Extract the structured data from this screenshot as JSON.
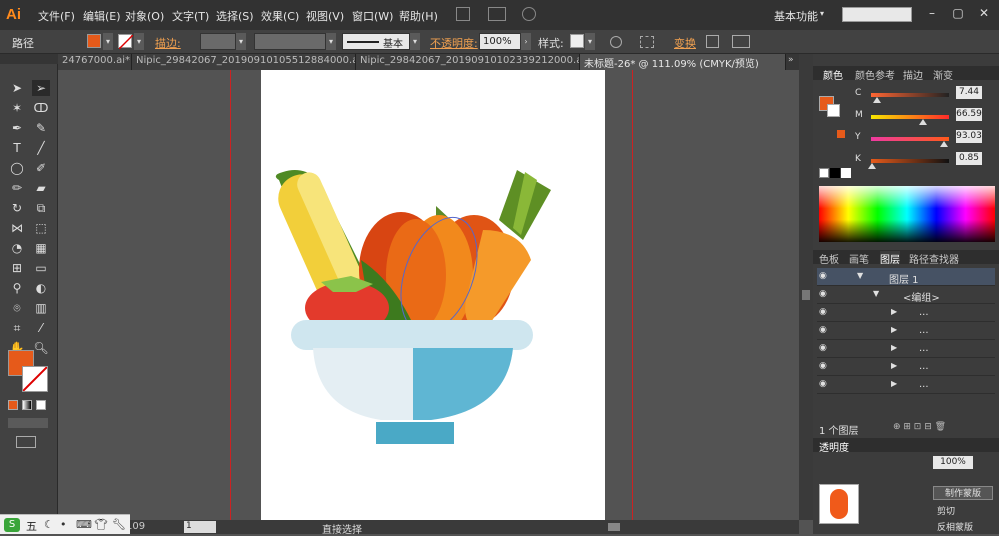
{
  "app": {
    "logo": "Ai"
  },
  "menu": [
    "文件(F)",
    "编辑(E)",
    "对象(O)",
    "文字(T)",
    "选择(S)",
    "效果(C)",
    "视图(V)",
    "窗口(W)",
    "帮助(H)"
  ],
  "workspace": "基本功能",
  "control": {
    "selection_label": "路径",
    "stroke_label": "描边:",
    "stroke_profile": "基本",
    "opacity_label": "不透明度:",
    "opacity_value": "100%",
    "style_label": "样式:",
    "transform_label": "变换"
  },
  "tabs": [
    {
      "label": "24767000.ai*",
      "active": false
    },
    {
      "label": "Nipic_29842067_20190910105512884000.ai*",
      "active": false
    },
    {
      "label": "Nipic_29842067_20190910102339212000.ai*",
      "active": false
    },
    {
      "label": "未标题-26* @ 111.09% (CMYK/预览)",
      "active": true
    }
  ],
  "status": {
    "zoom": "109",
    "page": "1",
    "tool": "直接选择"
  },
  "color_panel": {
    "tabs": [
      "颜色",
      "颜色参考",
      "描边",
      "渐变"
    ],
    "channels": [
      {
        "name": "C",
        "value": "7.44",
        "pct": 0.0744
      },
      {
        "name": "M",
        "value": "66.59",
        "pct": 0.6659
      },
      {
        "name": "Y",
        "value": "93.03",
        "pct": 0.9303
      },
      {
        "name": "K",
        "value": "0.85",
        "pct": 0.0085
      }
    ]
  },
  "layers_panel": {
    "tabs": [
      "色板",
      "画笔",
      "图层",
      "路径查找器"
    ],
    "rows": [
      {
        "label": "图层 1",
        "level": 0
      },
      {
        "label": "<编组>",
        "level": 1
      },
      {
        "label": "...",
        "level": 2
      },
      {
        "label": "...",
        "level": 2
      },
      {
        "label": "...",
        "level": 2
      },
      {
        "label": "...",
        "level": 2
      },
      {
        "label": "...",
        "level": 2
      }
    ],
    "footer": "1 个图层"
  },
  "transparency_panel": {
    "tab": "透明度",
    "opacity": "100%",
    "make_mask": "制作蒙版",
    "clip": "剪切",
    "invert": "反相蒙版"
  },
  "ime": {
    "label": "五"
  },
  "colors": {
    "fill": "#e65a1a",
    "accent": "#ff8a1c",
    "guide": "#cc2222"
  }
}
